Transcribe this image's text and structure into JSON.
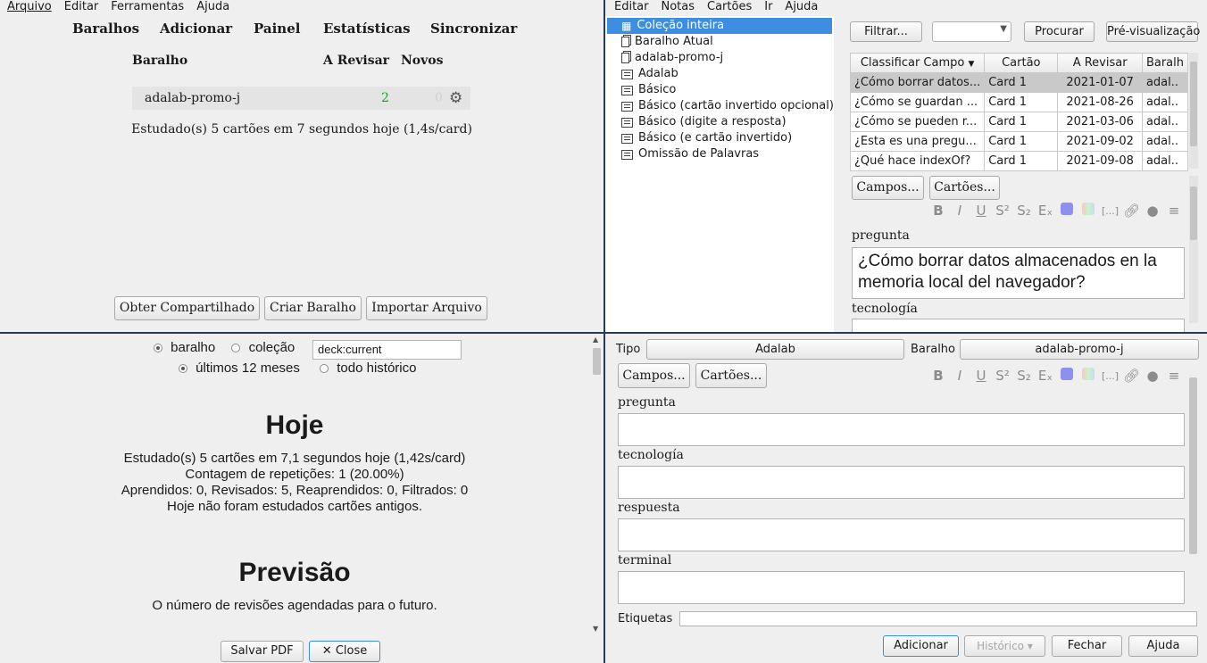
{
  "main": {
    "menu": [
      "Arquivo",
      "Editar",
      "Ferramentas",
      "Ajuda"
    ],
    "toolbar": [
      "Baralhos",
      "Adicionar",
      "Painel",
      "Estatísticas",
      "Sincronizar"
    ],
    "headers": {
      "deck": "Baralho",
      "review": "A Revisar",
      "new": "Novos"
    },
    "deck_row": {
      "name": "adalab-promo-j",
      "review": "2",
      "new": "0"
    },
    "studied": "Estudado(s) 5 cartões em 7 segundos hoje (1,4s/card)",
    "buttons": [
      "Obter Compartilhado",
      "Criar Baralho",
      "Importar Arquivo"
    ]
  },
  "browser": {
    "menu": [
      "Editar",
      "Notas",
      "Cartões",
      "Ir",
      "Ajuda"
    ],
    "tree": [
      {
        "label": "Coleção inteira",
        "icon": "collection-icon",
        "selected": true
      },
      {
        "label": "Baralho Atual",
        "icon": "card-icon"
      },
      {
        "label": "adalab-promo-j",
        "icon": "card-icon"
      },
      {
        "label": "Adalab",
        "icon": "note-type-icon"
      },
      {
        "label": "Básico",
        "icon": "note-type-icon"
      },
      {
        "label": "Básico (cartão invertido opcional)",
        "icon": "note-type-icon"
      },
      {
        "label": "Básico (digite a resposta)",
        "icon": "note-type-icon"
      },
      {
        "label": "Básico (e cartão invertido)",
        "icon": "note-type-icon"
      },
      {
        "label": "Omissão de Palavras",
        "icon": "note-type-icon"
      }
    ],
    "filter_button": "Filtrar...",
    "search_button": "Procurar",
    "preview_button": "Pré-visualização",
    "columns": [
      "Classificar Campo",
      "Cartão",
      "A Revisar",
      "Baralh"
    ],
    "rows": [
      [
        "¿Cómo borrar datos...",
        "Card 1",
        "2021-01-07",
        "adal.."
      ],
      [
        "¿Cómo se guardan ...",
        "Card 1",
        "2021-08-26",
        "adal.."
      ],
      [
        "¿Cómo se pueden r...",
        "Card 1",
        "2021-03-06",
        "adal.."
      ],
      [
        "¿Esta es una pregu...",
        "Card 1",
        "2021-09-02",
        "adal.."
      ],
      [
        "¿Qué hace indexOf?",
        "Card 1",
        "2021-09-08",
        "adal.."
      ]
    ],
    "fields_button": "Campos...",
    "cards_button": "Cartões...",
    "field1_label": "pregunta",
    "field1_value": "¿Cómo borrar datos almacenados en la memoria local del navegador?",
    "field2_label": "tecnología"
  },
  "stats": {
    "radio_deck": "baralho",
    "radio_collection": "coleção",
    "search_value": "deck:current",
    "radio_12m": "últimos 12 meses",
    "radio_all": "todo histórico",
    "today_title": "Hoje",
    "today_lines": [
      "Estudado(s) 5 cartões em 7,1 segundos hoje (1,42s/card)",
      "Contagem de repetições: 1 (20.00%)",
      "Aprendidos: 0, Revisados: 5, Reaprendidos: 0, Filtrados: 0",
      "Hoje não foram estudados cartões antigos."
    ],
    "forecast_title": "Previsão",
    "forecast_sub": "O número de revisões agendadas para o futuro.",
    "save_pdf": "Salvar PDF",
    "close": "Close"
  },
  "add": {
    "type_label": "Tipo",
    "type_value": "Adalab",
    "deck_label": "Baralho",
    "deck_value": "adalab-promo-j",
    "fields_button": "Campos...",
    "cards_button": "Cartões...",
    "fields": [
      "pregunta",
      "tecnología",
      "respuesta",
      "terminal"
    ],
    "tags_label": "Etiquetas",
    "add_button": "Adicionar",
    "history_button": "Histórico ▾",
    "close_button": "Fechar",
    "help_button": "Ajuda"
  },
  "colors": {
    "selection": "#3d8ee0",
    "row_selected": "#c9c9c9",
    "review_count": "#16a516",
    "divider": "#2b3a55"
  }
}
